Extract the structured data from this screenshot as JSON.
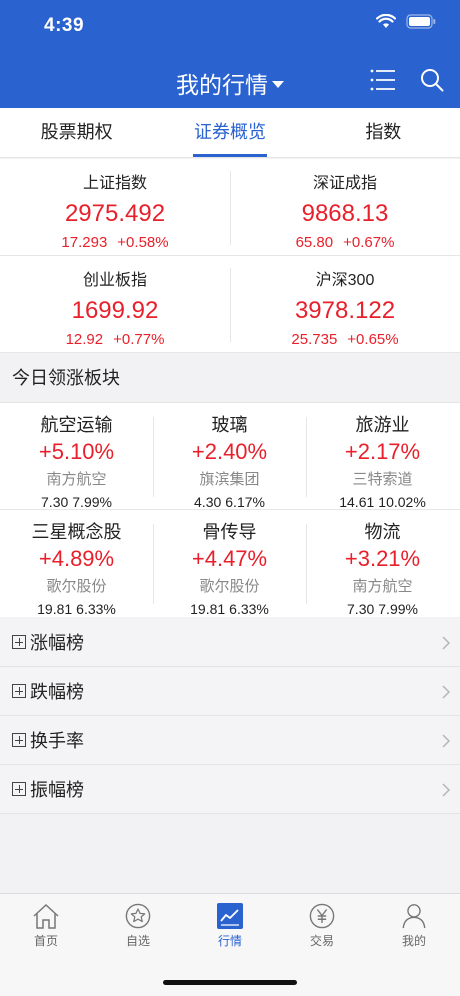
{
  "status_bar": {
    "time": "4:39"
  },
  "nav": {
    "title": "我的行情"
  },
  "tabs": [
    {
      "label": "股票期权"
    },
    {
      "label": "证券概览"
    },
    {
      "label": "指数"
    }
  ],
  "indices": [
    {
      "name": "上证指数",
      "value": "2975.492",
      "change": "17.293",
      "pct": "+0.58%"
    },
    {
      "name": "深证成指",
      "value": "9868.13",
      "change": "65.80",
      "pct": "+0.67%"
    },
    {
      "name": "创业板指",
      "value": "1699.92",
      "change": "12.92",
      "pct": "+0.77%"
    },
    {
      "name": "沪深300",
      "value": "3978.122",
      "change": "25.735",
      "pct": "+0.65%"
    }
  ],
  "sectors_section": {
    "title": "今日领涨板块"
  },
  "sectors": [
    {
      "name": "航空运输",
      "pct": "+5.10%",
      "leader": "南方航空",
      "price": "7.30",
      "leader_pct": "7.99%"
    },
    {
      "name": "玻璃",
      "pct": "+2.40%",
      "leader": "旗滨集团",
      "price": "4.30",
      "leader_pct": "6.17%"
    },
    {
      "name": "旅游业",
      "pct": "+2.17%",
      "leader": "三特索道",
      "price": "14.61",
      "leader_pct": "10.02%"
    },
    {
      "name": "三星概念股",
      "pct": "+4.89%",
      "leader": "歌尔股份",
      "price": "19.81",
      "leader_pct": "6.33%"
    },
    {
      "name": "骨传导",
      "pct": "+4.47%",
      "leader": "歌尔股份",
      "price": "19.81",
      "leader_pct": "6.33%"
    },
    {
      "name": "物流",
      "pct": "+3.21%",
      "leader": "南方航空",
      "price": "7.30",
      "leader_pct": "7.99%"
    }
  ],
  "rank_lists": [
    {
      "label": "涨幅榜"
    },
    {
      "label": "跌幅榜"
    },
    {
      "label": "换手率"
    },
    {
      "label": "振幅榜"
    }
  ],
  "tab_bar": [
    {
      "label": "首页",
      "icon": "home-icon"
    },
    {
      "label": "自选",
      "icon": "star-icon"
    },
    {
      "label": "行情",
      "icon": "chart-icon"
    },
    {
      "label": "交易",
      "icon": "yen-icon"
    },
    {
      "label": "我的",
      "icon": "person-icon"
    }
  ],
  "colors": {
    "brand": "#2a62d0",
    "up": "#e8202b"
  }
}
